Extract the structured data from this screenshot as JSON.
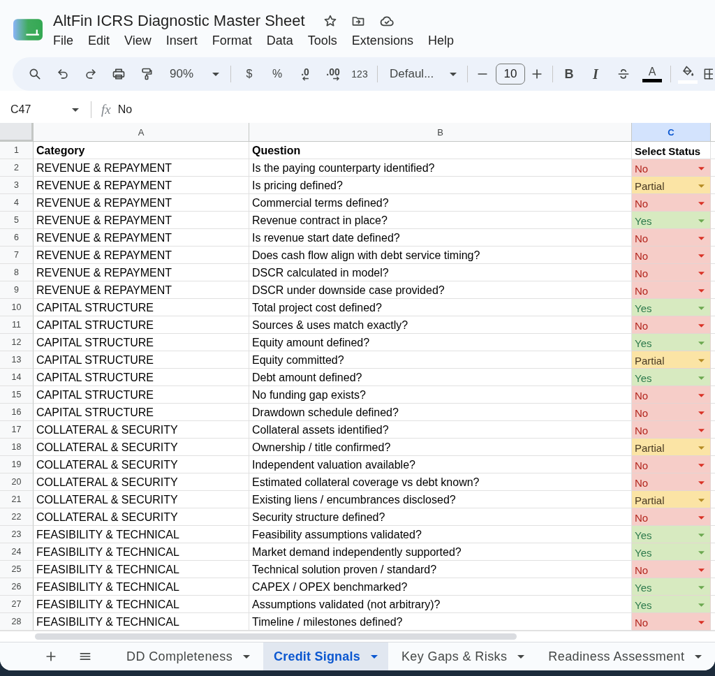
{
  "document": {
    "title": "AltFin ICRS Diagnostic Master Sheet",
    "menu": [
      "File",
      "Edit",
      "View",
      "Insert",
      "Format",
      "Data",
      "Tools",
      "Extensions",
      "Help"
    ]
  },
  "toolbar": {
    "zoom": "90%",
    "currency": "$",
    "percent": "%",
    "decrease_decimal": ".0",
    "increase_decimal": ".00",
    "number_format": "123",
    "font": "Defaul...",
    "font_size": "10",
    "bold": "B",
    "italic": "I",
    "text_color_label": "A"
  },
  "formula_bar": {
    "cell": "C47",
    "fx": "fx",
    "value": "No"
  },
  "sheet": {
    "columns": [
      {
        "label": "A",
        "selected": false
      },
      {
        "label": "B",
        "selected": false
      },
      {
        "label": "C",
        "selected": true
      }
    ],
    "header": {
      "number": "1",
      "cells": [
        "Category",
        "Question",
        "Select Status"
      ]
    },
    "rows": [
      {
        "number": "2",
        "category": "REVENUE & REPAYMENT",
        "question": "Is the paying counterparty identified?",
        "status": {
          "value": "No",
          "color": "#f6cdc8"
        }
      },
      {
        "number": "3",
        "category": "REVENUE & REPAYMENT",
        "question": "Is pricing defined?",
        "status": {
          "value": "Partial",
          "color": "#fbe4a5"
        }
      },
      {
        "number": "4",
        "category": "REVENUE & REPAYMENT",
        "question": "Commercial terms defined?",
        "status": {
          "value": "No",
          "color": "#f6cdc8"
        }
      },
      {
        "number": "5",
        "category": "REVENUE & REPAYMENT",
        "question": "Revenue contract in place?",
        "status": {
          "value": "Yes",
          "color": "#d7eac0"
        }
      },
      {
        "number": "6",
        "category": "REVENUE & REPAYMENT",
        "question": "Is revenue start date defined?",
        "status": {
          "value": "No",
          "color": "#f6cdc8"
        }
      },
      {
        "number": "7",
        "category": "REVENUE & REPAYMENT",
        "question": "Does cash flow align with debt service timing?",
        "status": {
          "value": "No",
          "color": "#f6cdc8"
        }
      },
      {
        "number": "8",
        "category": "REVENUE & REPAYMENT",
        "question": "DSCR calculated in model?",
        "status": {
          "value": "No",
          "color": "#f6cdc8"
        }
      },
      {
        "number": "9",
        "category": "REVENUE & REPAYMENT",
        "question": "DSCR under downside case provided?",
        "status": {
          "value": "No",
          "color": "#f6cdc8"
        }
      },
      {
        "number": "10",
        "category": "CAPITAL STRUCTURE",
        "question": "Total project cost defined?",
        "status": {
          "value": "Yes",
          "color": "#d7eac0"
        }
      },
      {
        "number": "11",
        "category": "CAPITAL STRUCTURE",
        "question": "Sources & uses match exactly?",
        "status": {
          "value": "No",
          "color": "#f6cdc8"
        }
      },
      {
        "number": "12",
        "category": "CAPITAL STRUCTURE",
        "question": "Equity amount defined?",
        "status": {
          "value": "Yes",
          "color": "#d7eac0"
        }
      },
      {
        "number": "13",
        "category": "CAPITAL STRUCTURE",
        "question": "Equity committed?",
        "status": {
          "value": "Partial",
          "color": "#fbe4a5"
        }
      },
      {
        "number": "14",
        "category": "CAPITAL STRUCTURE",
        "question": "Debt amount defined?",
        "status": {
          "value": "Yes",
          "color": "#d7eac0"
        }
      },
      {
        "number": "15",
        "category": "CAPITAL STRUCTURE",
        "question": "No funding gap exists?",
        "status": {
          "value": "No",
          "color": "#f6cdc8"
        }
      },
      {
        "number": "16",
        "category": "CAPITAL STRUCTURE",
        "question": "Drawdown schedule defined?",
        "status": {
          "value": "No",
          "color": "#f6cdc8"
        }
      },
      {
        "number": "17",
        "category": "COLLATERAL & SECURITY",
        "question": "Collateral assets identified?",
        "status": {
          "value": "No",
          "color": "#f6cdc8"
        }
      },
      {
        "number": "18",
        "category": "COLLATERAL & SECURITY",
        "question": "Ownership / title confirmed?",
        "status": {
          "value": "Partial",
          "color": "#fbe4a5"
        }
      },
      {
        "number": "19",
        "category": "COLLATERAL & SECURITY",
        "question": "Independent valuation available?",
        "status": {
          "value": "No",
          "color": "#f6cdc8"
        }
      },
      {
        "number": "20",
        "category": "COLLATERAL & SECURITY",
        "question": "Estimated collateral coverage vs debt known?",
        "status": {
          "value": "No",
          "color": "#f6cdc8"
        }
      },
      {
        "number": "21",
        "category": "COLLATERAL & SECURITY",
        "question": "Existing liens / encumbrances disclosed?",
        "status": {
          "value": "Partial",
          "color": "#fbe4a5"
        }
      },
      {
        "number": "22",
        "category": "COLLATERAL & SECURITY",
        "question": "Security structure defined?",
        "status": {
          "value": "No",
          "color": "#f6cdc8"
        }
      },
      {
        "number": "23",
        "category": "FEASIBILITY & TECHNICAL",
        "question": "Feasibility assumptions validated?",
        "status": {
          "value": "Yes",
          "color": "#d7eac0"
        }
      },
      {
        "number": "24",
        "category": "FEASIBILITY & TECHNICAL",
        "question": "Market demand independently supported?",
        "status": {
          "value": "Yes",
          "color": "#d7eac0"
        }
      },
      {
        "number": "25",
        "category": "FEASIBILITY & TECHNICAL",
        "question": "Technical solution proven / standard?",
        "status": {
          "value": "No",
          "color": "#f6cdc8"
        }
      },
      {
        "number": "26",
        "category": "FEASIBILITY & TECHNICAL",
        "question": "CAPEX / OPEX benchmarked?",
        "status": {
          "value": "Yes",
          "color": "#d7eac0"
        }
      },
      {
        "number": "27",
        "category": "FEASIBILITY & TECHNICAL",
        "question": "Assumptions validated (not arbitrary)?",
        "status": {
          "value": "Yes",
          "color": "#d7eac0"
        }
      },
      {
        "number": "28",
        "category": "FEASIBILITY & TECHNICAL",
        "question": "Timeline / milestones defined?",
        "status": {
          "value": "No",
          "color": "#f6cdc8"
        }
      }
    ]
  },
  "sheet_tabs": [
    {
      "label": "DD Completeness",
      "selected": false
    },
    {
      "label": "Credit Signals",
      "selected": true
    },
    {
      "label": "Key Gaps & Risks",
      "selected": false
    },
    {
      "label": "Readiness Assessment",
      "selected": false
    }
  ]
}
